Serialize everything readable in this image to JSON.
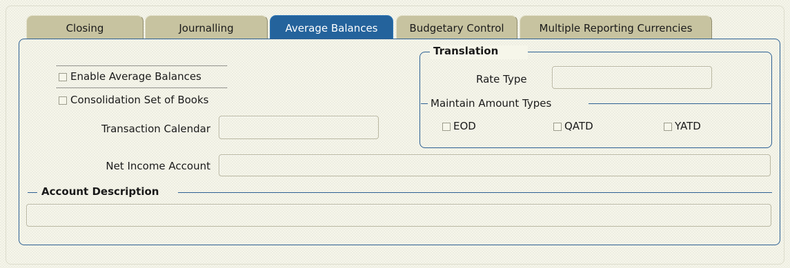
{
  "tabs": [
    {
      "label": "Closing",
      "active": false
    },
    {
      "label": "Journalling",
      "active": false
    },
    {
      "label": "Average Balances",
      "active": true
    },
    {
      "label": "Budgetary Control",
      "active": false
    },
    {
      "label": "Multiple Reporting Currencies",
      "active": false
    }
  ],
  "average_balances": {
    "enable_average_balances": {
      "label": "Enable Average Balances",
      "checked": false
    },
    "consolidation_set_of_books": {
      "label": "Consolidation Set of Books",
      "checked": false
    },
    "transaction_calendar": {
      "label": "Transaction Calendar",
      "value": ""
    },
    "net_income_account": {
      "label": "Net Income Account",
      "value": ""
    }
  },
  "translation": {
    "title": "Translation",
    "rate_type": {
      "label": "Rate Type",
      "value": ""
    },
    "maintain_amount_types": {
      "title": "Maintain Amount Types",
      "options": [
        {
          "label": "EOD",
          "checked": false
        },
        {
          "label": "QATD",
          "checked": false
        },
        {
          "label": "YATD",
          "checked": false
        }
      ]
    }
  },
  "account_description": {
    "title": "Account Description",
    "value": ""
  },
  "colors": {
    "active_tab": "#24639c",
    "inactive_tab": "#c7c3a0",
    "frame_line": "#2b5f93",
    "background": "#f6f6ea"
  }
}
